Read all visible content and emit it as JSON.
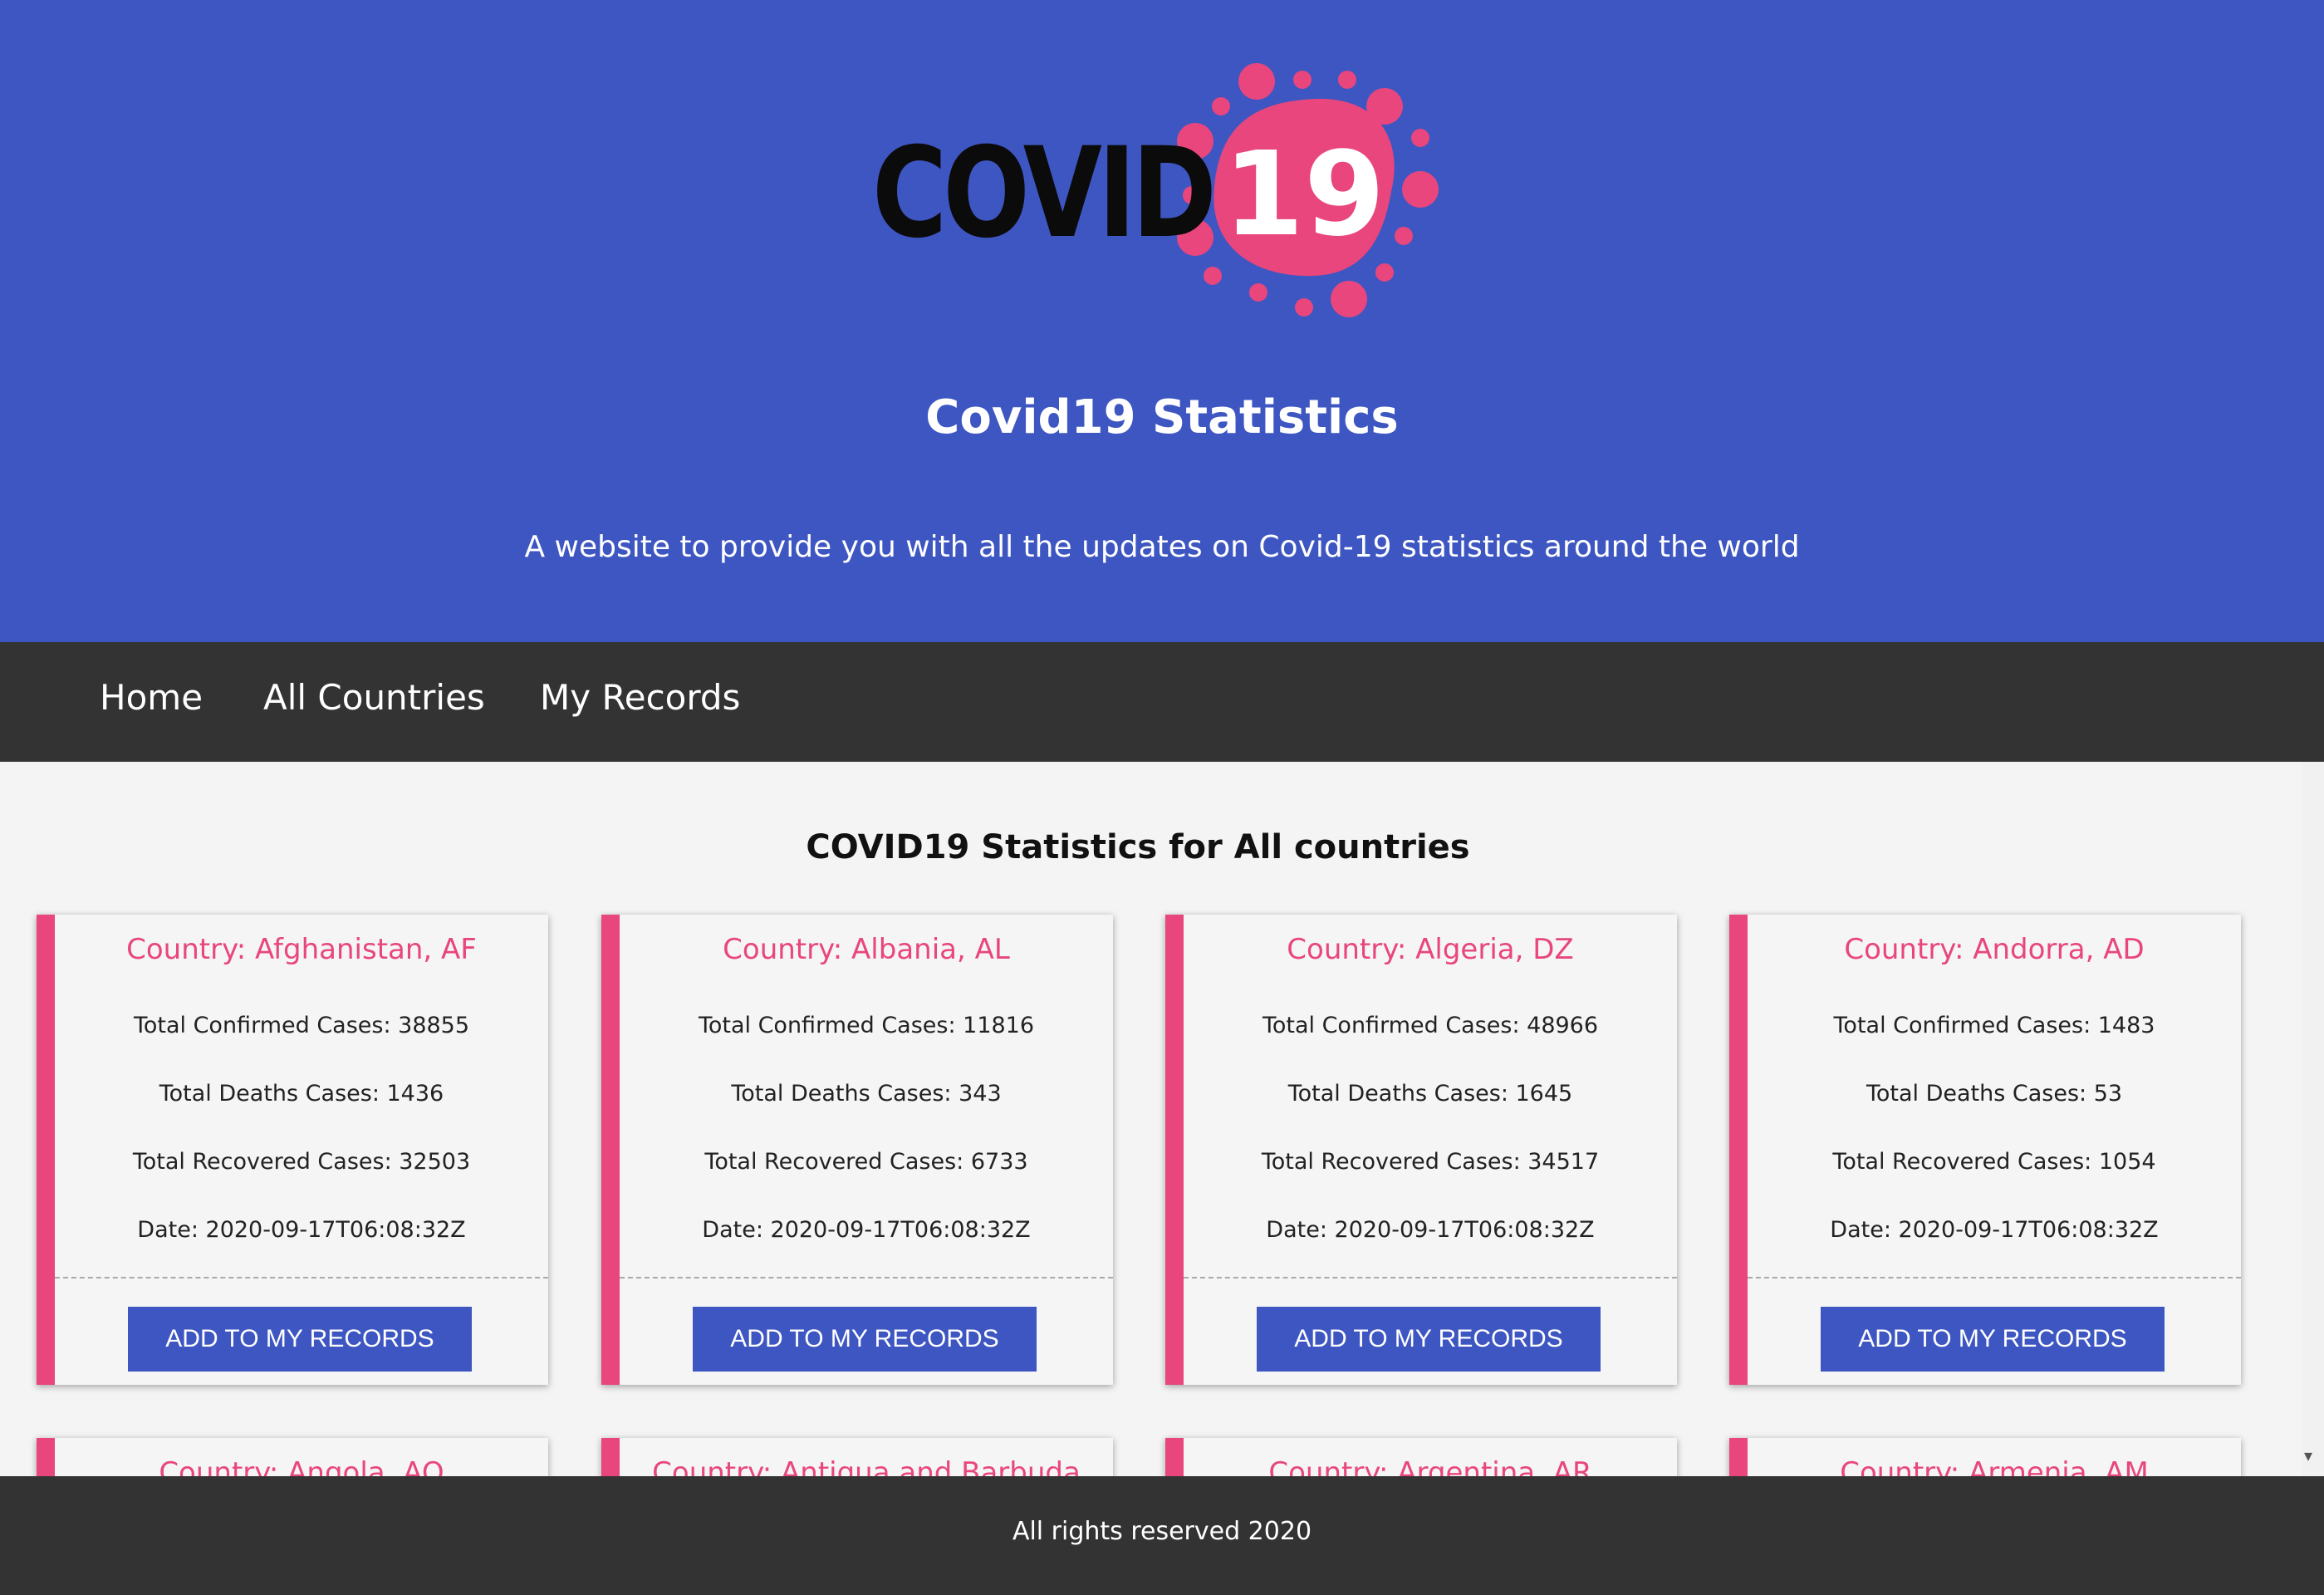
{
  "header": {
    "logo_word": "COVID",
    "logo_number": "19",
    "title": "Covid19 Statistics",
    "subtitle": "A website to provide you with all the updates on Covid-19 statistics around the world"
  },
  "nav": {
    "items": [
      {
        "label": "Home"
      },
      {
        "label": "All Countries"
      },
      {
        "label": "My Records"
      }
    ]
  },
  "main": {
    "section_title": "COVID19 Statistics for All countries",
    "cards": [
      {
        "country": "Country: Afghanistan, AF",
        "confirmed": "Total Confirmed Cases: 38855",
        "deaths": "Total Deaths Cases: 1436",
        "recovered": "Total Recovered Cases: 32503",
        "date": "Date: 2020-09-17T06:08:32Z",
        "button": "ADD TO MY RECORDS"
      },
      {
        "country": "Country: Albania, AL",
        "confirmed": "Total Confirmed Cases: 11816",
        "deaths": "Total Deaths Cases: 343",
        "recovered": "Total Recovered Cases: 6733",
        "date": "Date: 2020-09-17T06:08:32Z",
        "button": "ADD TO MY RECORDS"
      },
      {
        "country": "Country: Algeria, DZ",
        "confirmed": "Total Confirmed Cases: 48966",
        "deaths": "Total Deaths Cases: 1645",
        "recovered": "Total Recovered Cases: 34517",
        "date": "Date: 2020-09-17T06:08:32Z",
        "button": "ADD TO MY RECORDS"
      },
      {
        "country": "Country: Andorra, AD",
        "confirmed": "Total Confirmed Cases: 1483",
        "deaths": "Total Deaths Cases: 53",
        "recovered": "Total Recovered Cases: 1054",
        "date": "Date: 2020-09-17T06:08:32Z",
        "button": "ADD TO MY RECORDS"
      }
    ],
    "next_row": [
      {
        "country": "Country: Angola, AO"
      },
      {
        "country": "Country: Antigua and Barbuda"
      },
      {
        "country": "Country: Argentina, AR"
      },
      {
        "country": "Country: Armenia, AM"
      }
    ]
  },
  "footer": {
    "text": "All rights reserved 2020"
  },
  "colors": {
    "brand_blue": "#3e56c2",
    "accent_pink": "#e8467c",
    "nav_dark": "#333333"
  },
  "icons": {
    "scroll_down": "▾"
  }
}
